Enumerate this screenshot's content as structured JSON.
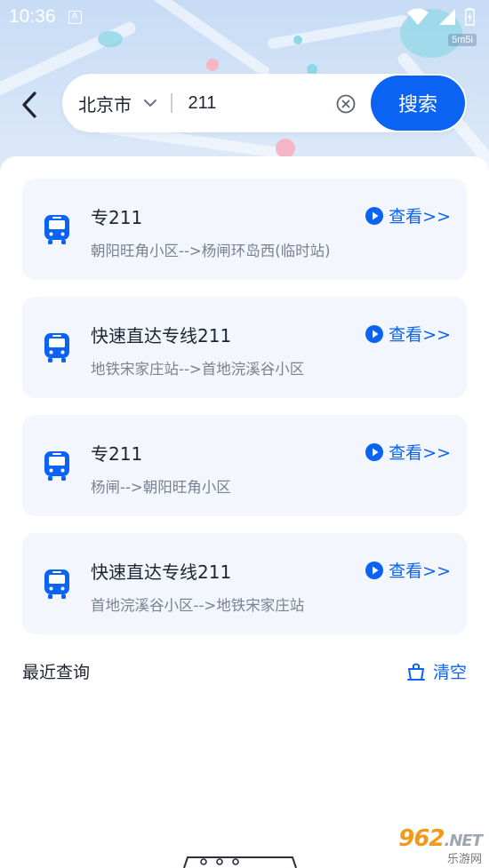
{
  "status_bar": {
    "time": "10:36",
    "badge_letter": "A",
    "speed": "5m5i"
  },
  "search": {
    "city": "北京市",
    "query": "211",
    "button_label": "搜索"
  },
  "results": [
    {
      "name": "专211",
      "desc": "朝阳旺角小区-->杨闸环岛西(临时站)",
      "action": "查看>>"
    },
    {
      "name": "快速直达专线211",
      "desc": "地铁宋家庄站-->首地浣溪谷小区",
      "action": "查看>>"
    },
    {
      "name": "专211",
      "desc": "杨闸-->朝阳旺角小区",
      "action": "查看>>"
    },
    {
      "name": "快速直达专线211",
      "desc": "首地浣溪谷小区-->地铁宋家庄站",
      "action": "查看>>"
    }
  ],
  "recent": {
    "title": "最近查询",
    "clear_label": "清空"
  },
  "watermark": {
    "brand": "962",
    "net": ".NET",
    "sub": "乐游网"
  },
  "colors": {
    "accent": "#0a63f2",
    "card_bg": "#f3f6fc",
    "desc_text": "#7a8190"
  },
  "icons": {
    "back": "chevron-left-icon",
    "dropdown": "chevron-down-icon",
    "clear": "clear-circle-icon",
    "bus": "bus-icon",
    "play": "play-circle-icon",
    "trash": "trash-icon"
  }
}
